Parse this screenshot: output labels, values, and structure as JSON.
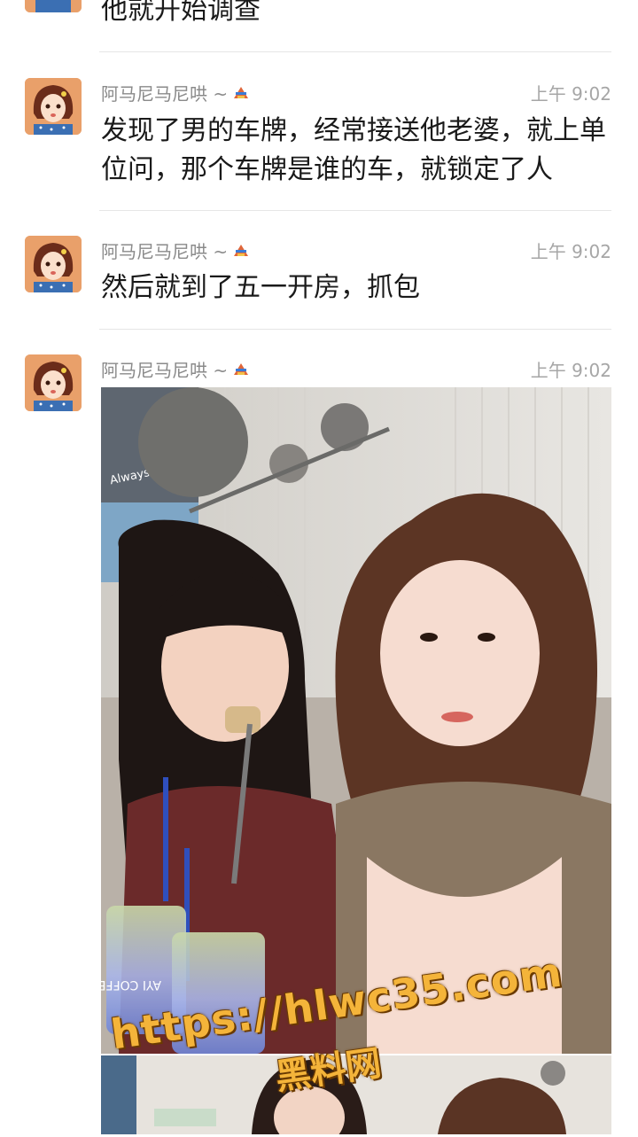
{
  "messages": [
    {
      "text": "他就开始调查"
    },
    {
      "sender": "阿马尼马尼哄 ~",
      "time": "上午 9:02",
      "text": "发现了男的车牌，经常接送他老婆，就上单位问，那个车牌是谁的车，就锁定了人"
    },
    {
      "sender": "阿马尼马尼哄 ~",
      "time": "上午 9:02",
      "text": "然后就到了五一开房，抓包"
    },
    {
      "sender": "阿马尼马尼哄 ~",
      "time": "上午 9:02"
    }
  ],
  "photo": {
    "wall_text": "Always beside",
    "cup_text": "AYI COFFEE"
  },
  "watermark": {
    "url": "https://hlwc35.com",
    "label": "黑料网"
  },
  "colors": {
    "name": "#8a8a8a",
    "time": "#a6a6a6",
    "message": "#1a1a1a",
    "watermark": "#f4b43a"
  }
}
